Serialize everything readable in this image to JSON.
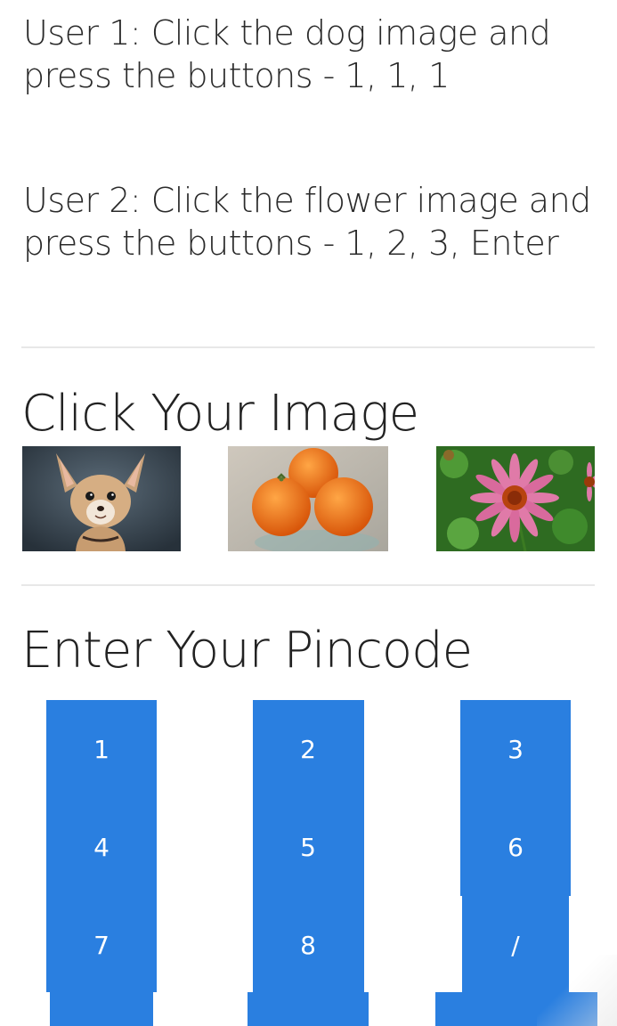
{
  "instructions": {
    "user1": "User 1: Click the dog image and\npress the buttons - 1, 1, 1",
    "user2": "User 2: Click the flower image and\npress the buttons - 1, 2, 3, Enter"
  },
  "images_section": {
    "heading": "Click Your Image",
    "images": [
      {
        "name": "dog",
        "icon": "chihuahua-photo"
      },
      {
        "name": "oranges",
        "icon": "oranges-photo"
      },
      {
        "name": "flower",
        "icon": "coneflower-photo"
      }
    ]
  },
  "pincode_section": {
    "heading": "Enter Your Pincode",
    "keys": {
      "k1": "1",
      "k2": "2",
      "k3": "3",
      "k4": "4",
      "k5": "5",
      "k6": "6",
      "k7": "7",
      "k8": "8",
      "k9": "/"
    }
  },
  "colors": {
    "key_background": "#2a7fe0",
    "key_text": "#ffffff",
    "divider": "#e8e8e8"
  }
}
